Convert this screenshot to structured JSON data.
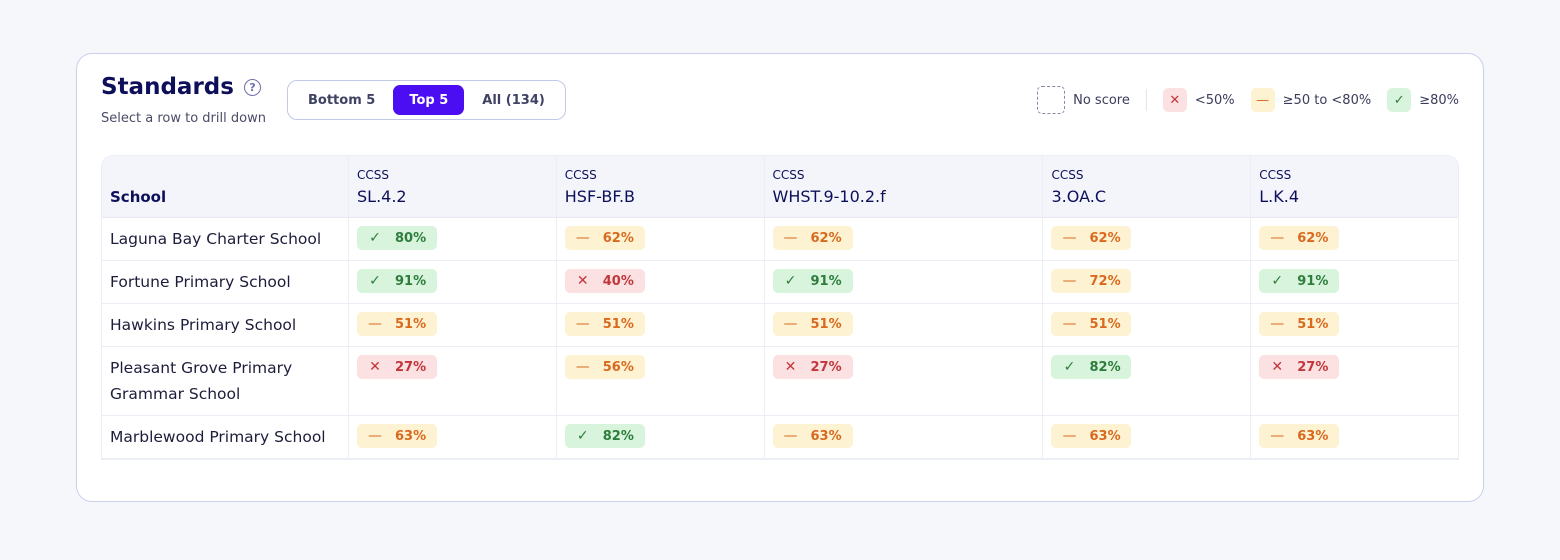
{
  "header": {
    "title": "Standards",
    "help_icon": "question-circle-icon",
    "subtitle": "Select a row to drill down"
  },
  "filters": {
    "options": [
      "Bottom 5",
      "Top 5",
      "All (134)"
    ],
    "selected": "Top 5"
  },
  "legend": {
    "no_score": "No score",
    "low": "<50%",
    "mid": "≥50 to <80%",
    "high": "≥80%",
    "colors": {
      "low": "#fbe1e1",
      "mid": "#fdf3d3",
      "high": "#d8f4dd",
      "accent": "#4b0df2"
    }
  },
  "table": {
    "school_header": "School",
    "columns": [
      {
        "prefix": "CCSS",
        "code": "SL.4.2"
      },
      {
        "prefix": "CCSS",
        "code": "HSF-BF.B"
      },
      {
        "prefix": "CCSS",
        "code": "WHST.9-10.2.f"
      },
      {
        "prefix": "CCSS",
        "code": "3.OA.C"
      },
      {
        "prefix": "CCSS",
        "code": "L.K.4"
      }
    ],
    "rows": [
      {
        "school": "Laguna Bay Charter School",
        "scores": [
          "80%",
          "62%",
          "62%",
          "62%",
          "62%"
        ],
        "levels": [
          "high",
          "mid",
          "mid",
          "mid",
          "mid"
        ]
      },
      {
        "school": "Fortune Primary School",
        "scores": [
          "91%",
          "40%",
          "91%",
          "72%",
          "91%"
        ],
        "levels": [
          "high",
          "low",
          "high",
          "mid",
          "high"
        ]
      },
      {
        "school": "Hawkins Primary School",
        "scores": [
          "51%",
          "51%",
          "51%",
          "51%",
          "51%"
        ],
        "levels": [
          "mid",
          "mid",
          "mid",
          "mid",
          "mid"
        ]
      },
      {
        "school": "Pleasant Grove Primary Grammar School",
        "scores": [
          "27%",
          "56%",
          "27%",
          "82%",
          "27%"
        ],
        "levels": [
          "low",
          "mid",
          "low",
          "high",
          "low"
        ]
      },
      {
        "school": "Marblewood Primary School",
        "scores": [
          "63%",
          "82%",
          "63%",
          "63%",
          "63%"
        ],
        "levels": [
          "mid",
          "high",
          "mid",
          "mid",
          "mid"
        ]
      }
    ]
  }
}
